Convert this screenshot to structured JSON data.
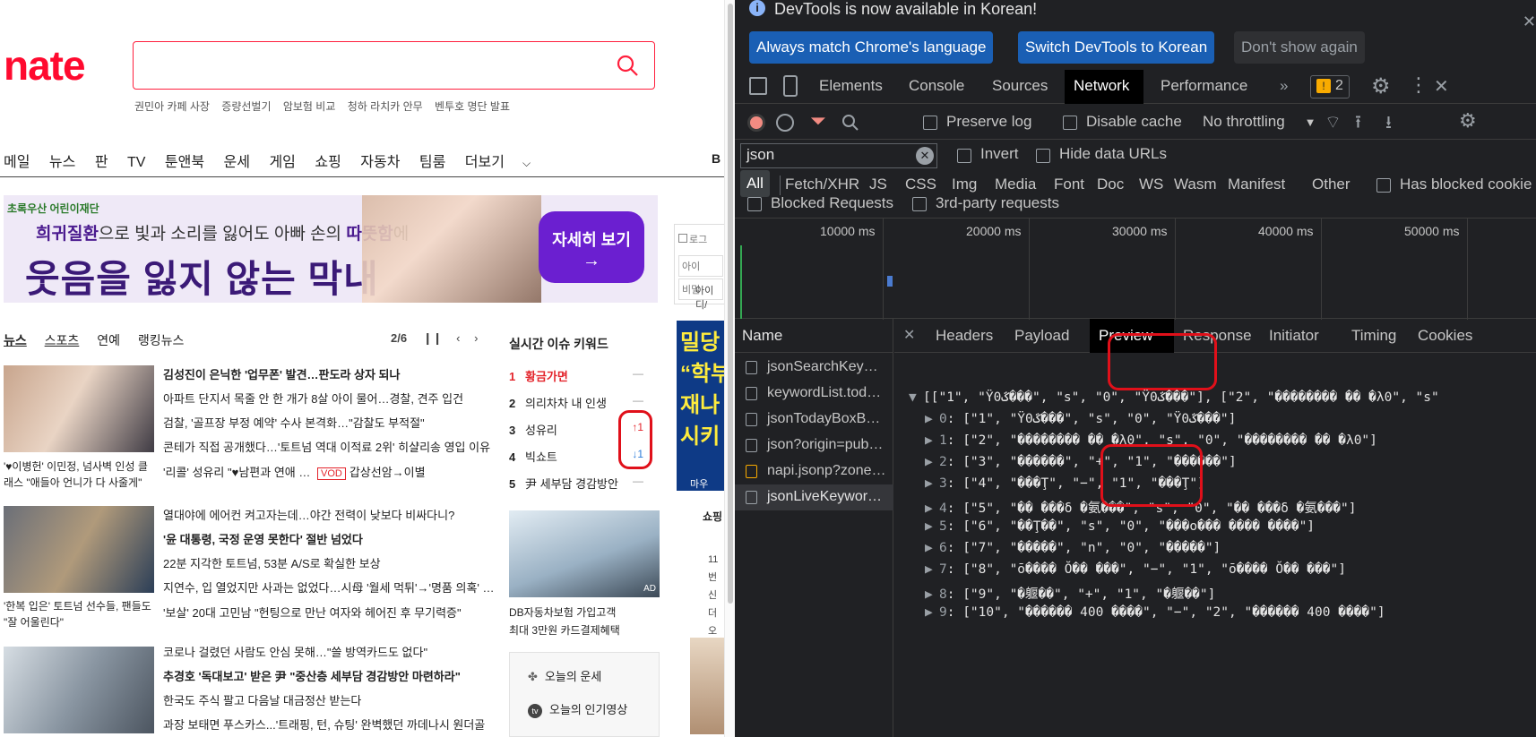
{
  "nate": {
    "logo": "nate",
    "trending_links": [
      "권민아 카페 사장",
      "증량선벌기",
      "암보험 비교",
      "청하 라치카 안무",
      "벤투호 명단 발표"
    ],
    "nav": [
      "메일",
      "뉴스",
      "판",
      "TV",
      "툰앤북",
      "운세",
      "게임",
      "쇼핑",
      "자동차",
      "팀룸",
      "더보기"
    ],
    "nav_more_icon": "chevron-down-icon",
    "banner": {
      "brand": "초록우산 어린이재단",
      "line1_a": "희귀질환",
      "line1_b": "으로 빛과 소리를 잃어도 아빠 손의 ",
      "line1_c": "따뜻함",
      "line1_d": "에",
      "line2": "웃음을 잃지 않는 막내",
      "cta": "자세히 보기",
      "cta_arrow": "→"
    },
    "login": {
      "chk": "로그",
      "id": "아이",
      "pw": "비밀",
      "link": "아이디/"
    },
    "news_tabs": [
      "뉴스",
      "스포츠",
      "연예",
      "랭킹뉴스"
    ],
    "pager": "2/6",
    "news_blocks": [
      {
        "caption": "'♥이병헌' 이민정, 넘사벽 인성 클래스 \"애들아 언니가 다 사줄게\"",
        "items": [
          "김성진이 은닉한 '업무폰' 발견…판도라 상자 되나",
          "아파트 단지서 목줄 안 한 개가 8살 아이 물어…경찰, 견주 입건",
          "검찰, '골프장 부정 예약' 수사 본격화…\"감찰도 부적절\"",
          "콘테가 직접 공개했다…'토트넘 역대 이적료 2위' 히샬리송 영입 이유",
          "'리콜' 성유리 \"♥남편과 연애 …"
        ],
        "vod": "VOD",
        "vod_text": "갑상선암→이별"
      },
      {
        "caption": "'한복 입은' 토트넘 선수들, 팬들도 \"잘 어울린다\"",
        "items": [
          "열대야에 에어컨 켜고자는데…야간 전력이 낮보다 비싸다니?",
          "'윤 대통령, 국정 운영 못한다' 절반 넘었다",
          "22분 지각한 토트넘, 53분 A/S로 확실한 보상",
          "지연수, 입 열었지만 사과는 없었다…시母 '월세 먹튀'→'명품 의혹' …",
          "'보살' 20대 고민남 \"헌팅으로 만난 여자와 헤어진 후 무기력증\""
        ]
      },
      {
        "caption": "",
        "items": [
          "코로나 걸렸던 사람도 안심 못해…\"쓸 방역카드도 없다\"",
          "추경호 '독대보고' 받은 尹 \"중산층 세부담 경감방안 마련하라\"",
          "한국도 주식 팔고 다음날 대금정산 받는다",
          "과장 보태면 푸스카스...'트래핑, 턴, 슈팅' 완벽했던 까데나시 원더골"
        ]
      }
    ],
    "realtime": {
      "title": "실시간 이슈 키워드",
      "items": [
        {
          "rank": "1",
          "text": "황금가면",
          "move": "—"
        },
        {
          "rank": "2",
          "text": "의리차차 내 인생",
          "move": "—"
        },
        {
          "rank": "3",
          "text": "성유리",
          "move": "↑1"
        },
        {
          "rank": "4",
          "text": "빅쇼트",
          "move": "↓1"
        },
        {
          "rank": "5",
          "text": "尹 세부담 경감방안",
          "move": "—"
        }
      ]
    },
    "ad": {
      "badge": "AD",
      "line1": "DB자동차보험 가입고객",
      "line2": "최대 3만원 카드결제혜택"
    },
    "side_links": [
      "오늘의 운세",
      "오늘의 인기영상"
    ],
    "vertical_banner": "밀당\n“학부\n재나\n시키",
    "vertical_small": "마우",
    "shop_label": "쇼핑",
    "shop_lines": [
      "11번",
      "신더",
      "오드"
    ]
  },
  "devtools": {
    "notice": "DevTools is now available in Korean!",
    "btn_match": "Always match Chrome's language",
    "btn_switch": "Switch DevTools to Korean",
    "btn_dont": "Don't show again",
    "panels": [
      "Elements",
      "Console",
      "Sources",
      "Network",
      "Performance"
    ],
    "more_panels": "»",
    "issues_count": "2",
    "preserve_log": "Preserve log",
    "disable_cache": "Disable cache",
    "throttling": "No throttling",
    "filter_value": "json",
    "invert": "Invert",
    "hide_data_urls": "Hide data URLs",
    "types": [
      "All",
      "Fetch/XHR",
      "JS",
      "CSS",
      "Img",
      "Media",
      "Font",
      "Doc",
      "WS",
      "Wasm",
      "Manifest",
      "Other"
    ],
    "has_blocked_cookies": "Has blocked cookie",
    "blocked_requests": "Blocked Requests",
    "third_party": "3rd-party requests",
    "timeline_labels": [
      "10000 ms",
      "20000 ms",
      "30000 ms",
      "40000 ms",
      "50000 ms"
    ],
    "name_header": "Name",
    "requests": [
      "jsonSearchKey…",
      "keywordList.tod…",
      "jsonTodayBoxB…",
      "json?origin=pub…",
      "napi.jsonp?zone…",
      "jsonLiveKeywor…"
    ],
    "detail_tabs": [
      "Headers",
      "Payload",
      "Preview",
      "Response",
      "Initiator",
      "Timing",
      "Cookies"
    ],
    "preview_root": "[[\"1\", \"Ÿ0ػ���\", \"s\", \"0\", \"Ÿ0ػ���\"], [\"2\", \"�������� �� �λ0\", \"s\"",
    "preview_rows": [
      {
        "key": "0",
        "val": "[\"1\", \"Ÿ0ػ���\", \"s\", \"0\", \"Ÿ0ػ���\"]"
      },
      {
        "key": "1",
        "val": "[\"2\", \"�������� �� �λ0\", \"s\", \"0\", \"�������� �� �λ0\"]"
      },
      {
        "key": "2",
        "val": "[\"3\", \"������\", \"+\", \"1\", \"������\"]"
      },
      {
        "key": "3",
        "val": "[\"4\", \"���Ţ\", \"−\", \"1\", \"���Ţ\"]"
      },
      {
        "key": "4",
        "val": "[\"5\", \"�� ���δ �氨���\", \"s\", \"0\", \"�� ���δ �氨���\"]"
      },
      {
        "key": "5",
        "val": "[\"6\", \"��Ţ��\", \"s\", \"0\", \"���ο��� ���� ����\"]"
      },
      {
        "key": "6",
        "val": "[\"7\", \"�����\", \"n\", \"0\", \"�����\"]"
      },
      {
        "key": "7",
        "val": "[\"8\", \"ō���� Ŏ�� ���\", \"−\", \"1\", \"ō���� Ŏ�� ���\"]"
      },
      {
        "key": "8",
        "val": "[\"9\", \"�躽��\", \"+\", \"1\", \"�躽��\"]"
      },
      {
        "key": "9",
        "val": "[\"10\", \"������ 400 ����\", \"−\", \"2\", \"������ 400 ����\"]"
      }
    ],
    "colors": {
      "accent_red": "#e0101a",
      "devtools_blue": "#1a5fb4",
      "nate_red": "#ff0a2f"
    }
  }
}
